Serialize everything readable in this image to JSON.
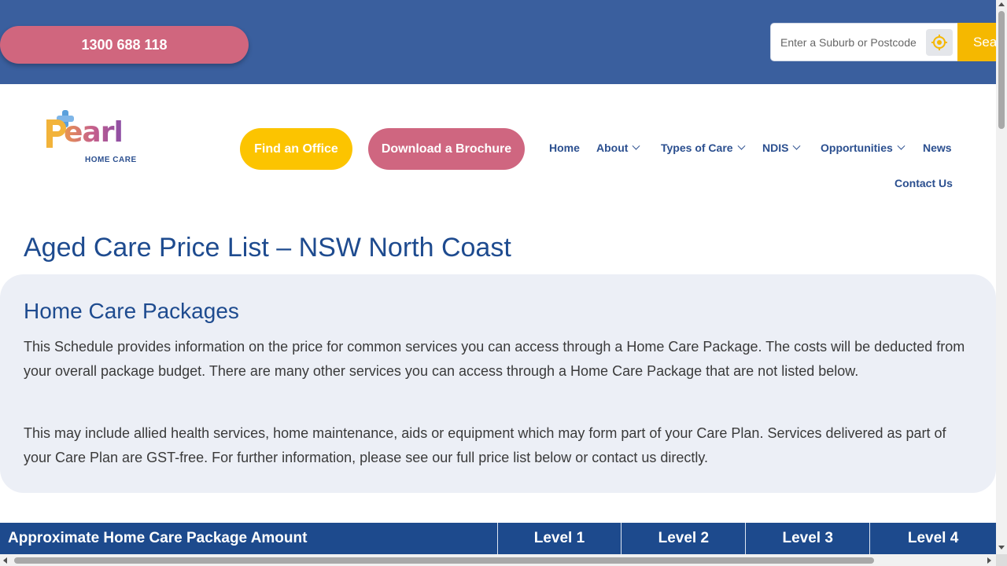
{
  "topbar": {
    "phone_label": "1300 688 118",
    "search_placeholder": "Enter a Suburb or Postcode",
    "search_button_label": "Search",
    "locate_icon": "crosshair-location-icon",
    "colors": {
      "bar": "#3a5f9e",
      "phone": "#d0667e",
      "search": "#f5b800"
    }
  },
  "header": {
    "logo_text": "earl",
    "logo_sub": "HOME CARE",
    "find_office_label": "Find an Office",
    "brochure_label": "Download a Brochure",
    "nav": [
      {
        "label": "Home"
      },
      {
        "label": "About"
      },
      {
        "label": "Types of Care"
      },
      {
        "label": "NDIS"
      },
      {
        "label": "Opportunities"
      },
      {
        "label": "News"
      },
      {
        "label": "Contact Us"
      }
    ]
  },
  "main": {
    "page_title": "Aged Care Price List – NSW North Coast",
    "section_title": "Home Care Packages",
    "paragraph_1": "This Schedule provides information on the price for common services you can access through a Home Care Package. The costs will be deducted from your overall package budget. There are many other services you can access through a Home Care Package that are not listed below.",
    "paragraph_2": "This may include allied health services, home maintenance, aids or equipment which may form part of your Care Plan. Services delivered as part of your Care Plan are GST-free. For further information, please see our full price list below or contact us directly."
  },
  "table": {
    "headers": [
      "Approximate Home Care Package Amount",
      "Level 1",
      "Level 2",
      "Level 3",
      "Level 4"
    ],
    "header_color": "#1d4a8d"
  }
}
